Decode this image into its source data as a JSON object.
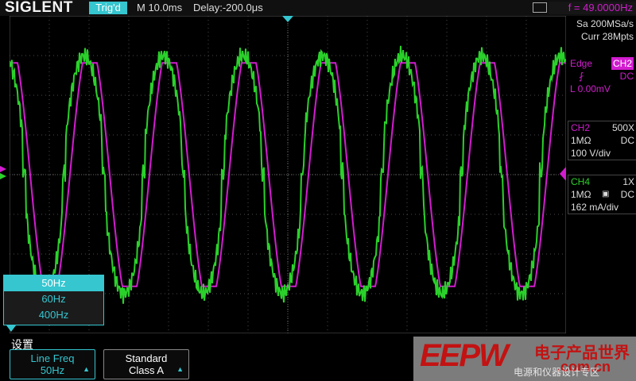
{
  "header": {
    "brand": "SIGLENT",
    "trigger_status": "Trig'd",
    "timebase": "M 10.0ms",
    "delay": "Delay:-200.0μs",
    "frequency": "f = 49.0000Hz",
    "usb_icon": "usb-icon"
  },
  "acquisition": {
    "sample_rate": "Sa 200MSa/s",
    "memory": "Curr 28Mpts"
  },
  "trigger": {
    "type": "Edge",
    "source": "CH2",
    "slope_icon": "rising-edge-icon",
    "coupling": "DC",
    "level": "L 0.00mV"
  },
  "channels": [
    {
      "name": "CH2",
      "probe": "500X",
      "impedance": "1MΩ",
      "coupling": "DC",
      "scale": "100 V/div",
      "color": "#d21ccf"
    },
    {
      "name": "CH4",
      "probe": "1X",
      "impedance": "1MΩ",
      "coupling": "DC",
      "scale": "162 mA/div",
      "color": "#2bd12b"
    }
  ],
  "menu": {
    "options": [
      "50Hz",
      "60Hz",
      "400Hz"
    ],
    "selected": "50Hz"
  },
  "settings_label": "设置",
  "softkeys": [
    {
      "title": "Line Freq",
      "value": "50Hz"
    },
    {
      "title": "Standard",
      "value": "Class A"
    }
  ],
  "watermark": {
    "brand": "EEPW",
    "cn_text": "电子产品世界",
    "site": ".com.cn",
    "sub": "电源和仪器设计专区"
  },
  "colors": {
    "accent": "#35c6d0",
    "ch2": "#d21ccf",
    "ch4": "#2bd12b",
    "background": "#000000"
  }
}
